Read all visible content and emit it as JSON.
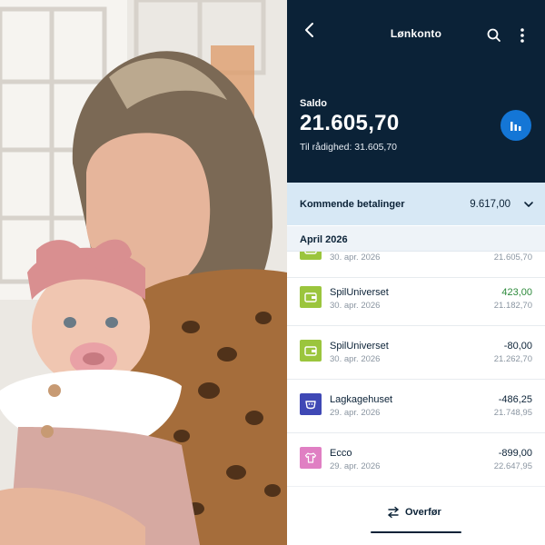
{
  "header": {
    "title": "Lønkonto"
  },
  "balance": {
    "label": "Saldo",
    "amount": "21.605,70",
    "available": "Til rådighed: 31.605,70"
  },
  "upcoming": {
    "label": "Kommende betalinger",
    "amount": "9.617,00"
  },
  "month": "April 2026",
  "transactions": [
    {
      "name": "",
      "date": "30. apr. 2026",
      "amount": "",
      "balance": "21.605,70",
      "icon": "wallet-icon",
      "icon_color": "#9bc53d"
    },
    {
      "name": "SpilUniverset",
      "date": "30. apr. 2026",
      "amount": "423,00",
      "balance": "21.182,70",
      "icon": "wallet-icon",
      "icon_color": "#9bc53d",
      "positive": true
    },
    {
      "name": "SpilUniverset",
      "date": "30. apr. 2026",
      "amount": "-80,00",
      "balance": "21.262,70",
      "icon": "wallet-icon",
      "icon_color": "#9bc53d"
    },
    {
      "name": "Lagkagehuset",
      "date": "29. apr. 2026",
      "amount": "-486,25",
      "balance": "21.748,95",
      "icon": "food-icon",
      "icon_color": "#3f48b5"
    },
    {
      "name": "Ecco",
      "date": "29. apr. 2026",
      "amount": "-899,00",
      "balance": "22.647,95",
      "icon": "shirt-icon",
      "icon_color": "#e07fc3"
    }
  ],
  "footer": {
    "transfer_label": "Overfør"
  },
  "colors": {
    "header_bg": "#0b2237",
    "accent": "#1476d6",
    "upcoming_bg": "#d7e8f5",
    "positive": "#2d8a3b"
  }
}
